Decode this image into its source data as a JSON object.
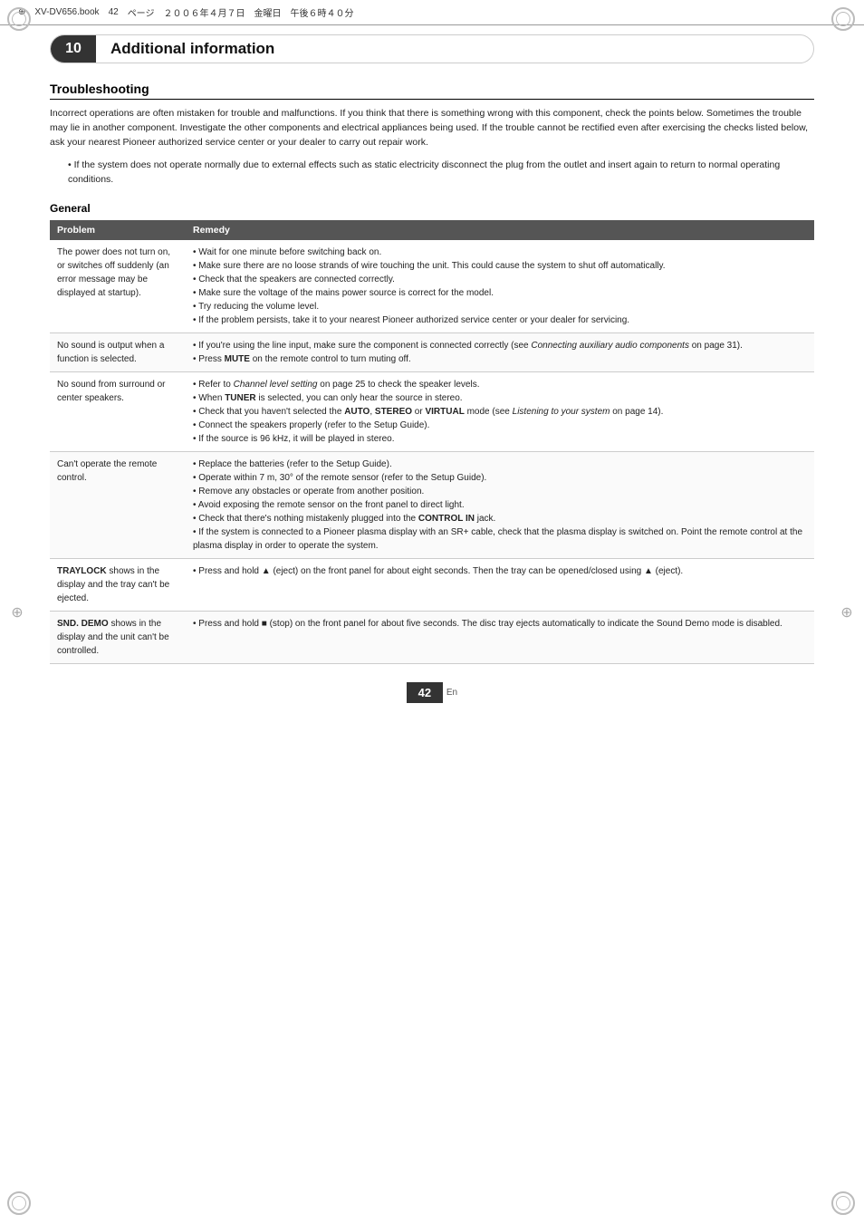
{
  "file_header": {
    "arrow": "⊕",
    "filename": "XV-DV656.book",
    "page": "42",
    "unit": "ページ",
    "year": "２００６年４月７日",
    "day": "金曜日",
    "time": "午後６時４０分"
  },
  "chapter": {
    "number": "10",
    "title": "Additional information"
  },
  "troubleshooting": {
    "section_title": "Troubleshooting",
    "intro_paragraph": "Incorrect operations are often mistaken for trouble and malfunctions. If you think that there is something wrong with this component, check the points below. Sometimes the trouble may lie in another component. Investigate the other components and electrical appliances being used. If the trouble cannot be rectified even after exercising the checks listed below, ask your nearest Pioneer authorized service center or your dealer to carry out repair work.",
    "bullet": "If the system does not operate normally due to external effects such as static electricity disconnect the plug from the outlet and insert again to return to normal operating conditions.",
    "general_title": "General",
    "table_headers": [
      "Problem",
      "Remedy"
    ],
    "rows": [
      {
        "problem": "The power does not turn on, or switches off suddenly (an error message may be displayed at startup).",
        "remedy": "• Wait for one minute before switching back on.\n• Make sure there are no loose strands of wire touching the unit. This could cause the system to shut off automatically.\n• Check that the speakers are connected correctly.\n• Make sure the voltage of the mains power source is correct for the model.\n• Try reducing the volume level.\n• If the problem persists, take it to your nearest Pioneer authorized service center or your dealer for servicing."
      },
      {
        "problem": "No sound is output when a function is selected.",
        "remedy": "• If you're using the line input, make sure the component is connected correctly (see Connecting auxiliary audio components on page 31).\n• Press MUTE on the remote control to turn muting off."
      },
      {
        "problem": "No sound from surround or center speakers.",
        "remedy": "• Refer to Channel level setting on page 25 to check the speaker levels.\n• When TUNER is selected, you can only hear the source in stereo.\n• Check that you haven't selected the AUTO, STEREO or VIRTUAL mode (see Listening to your system on page 14).\n• Connect the speakers properly (refer to the Setup Guide).\n• If the source is 96 kHz, it will be played in stereo."
      },
      {
        "problem": "Can't operate the remote control.",
        "remedy": "• Replace the batteries (refer to the Setup Guide).\n• Operate within 7 m, 30° of the remote sensor (refer to the Setup Guide).\n• Remove any obstacles or operate from another position.\n• Avoid exposing the remote sensor on the front panel to direct light.\n• Check that there's nothing mistakenly plugged into the CONTROL IN jack.\n• If the system is connected to a Pioneer plasma display with an SR+ cable, check that the plasma display is switched on. Point the remote control at the plasma display in order to operate the system."
      },
      {
        "problem": "TRAYLOCK shows in the display and the tray can't be ejected.",
        "remedy": "• Press and hold ▲ (eject) on the front panel for about eight seconds. Then the tray can be opened/closed using ▲ (eject).",
        "problem_bold": "TRAYLOCK"
      },
      {
        "problem": "SND. DEMO shows in the display and the unit can't be controlled.",
        "remedy": "• Press and hold ■ (stop) on the front panel for about five seconds. The disc tray ejects automatically to indicate the Sound Demo mode is disabled.",
        "problem_bold": "SND. DEMO"
      }
    ]
  },
  "footer": {
    "page_number": "42",
    "lang": "En"
  }
}
